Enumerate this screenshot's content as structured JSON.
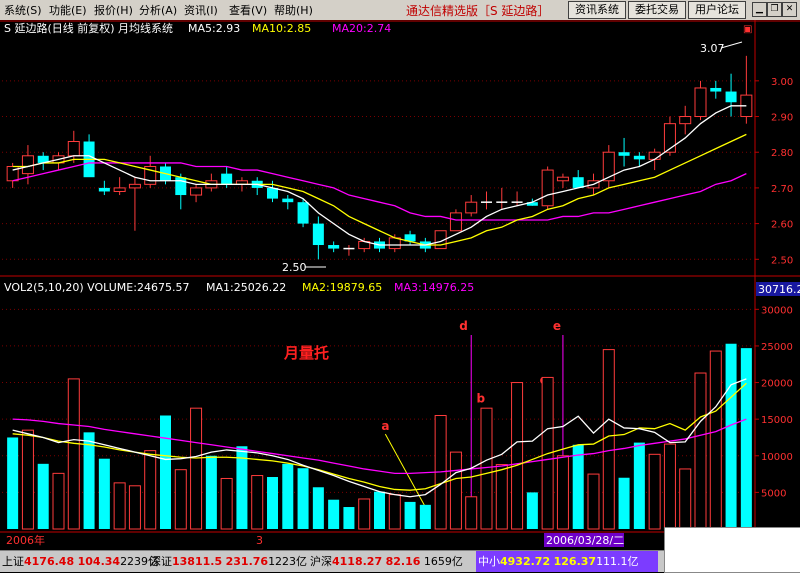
{
  "menubar": {
    "items": [
      "系统(S)",
      "功能(E)",
      "报价(H)",
      "分析(A)",
      "资讯(I)",
      "查看(V)",
      "帮助(H)"
    ],
    "app_title": "通达信精选版［S 延边路］",
    "buttons": [
      "资讯系统",
      "委托交易",
      "用户论坛"
    ],
    "window_controls": [
      "minimize-icon",
      "restore-icon",
      "close-icon"
    ]
  },
  "price_panel": {
    "title": "S 延边路(日线 前复权) 月均线系统",
    "ma5": "MA5:2.93",
    "ma10": "MA10:2.85",
    "ma20": "MA20:2.74",
    "peak_label": "3.07",
    "low_label": "2.50",
    "yticks": [
      "3.00",
      "2.90",
      "2.80",
      "2.70",
      "2.60",
      "2.50"
    ]
  },
  "volume_panel": {
    "title": "VOL2(5,10,20) VOLUME:24675.57",
    "ma1": "MA1:25026.22",
    "ma2": "MA2:19879.65",
    "ma3": "MA3:14976.25",
    "top_readout": "30716.2",
    "yticks": [
      "30000",
      "25000",
      "20000",
      "15000",
      "10000",
      "5000"
    ],
    "annotation_title": "月量托",
    "markers": [
      "a",
      "b",
      "c",
      "d",
      "e"
    ],
    "xlabel_left": "2006年",
    "xlabel_mid": "3",
    "date_readout": "2006/03/28/二"
  },
  "colors": {
    "up": "#ff3c3c",
    "down": "#00ffff",
    "ma_white": "#ffffff",
    "ma_yellow": "#ffff00",
    "ma_magenta": "#ff00ff",
    "grid": "#7a0000",
    "axis": "#c00000"
  },
  "chart_data": {
    "type": "candlestick",
    "price": {
      "ylim": [
        2.47,
        3.12
      ],
      "candles": [
        [
          2.72,
          2.77,
          2.7,
          2.76
        ],
        [
          2.74,
          2.82,
          2.71,
          2.79
        ],
        [
          2.79,
          2.8,
          2.75,
          2.77
        ],
        [
          2.77,
          2.8,
          2.75,
          2.79
        ],
        [
          2.79,
          2.86,
          2.77,
          2.83
        ],
        [
          2.83,
          2.85,
          2.74,
          2.73
        ],
        [
          2.7,
          2.72,
          2.68,
          2.69
        ],
        [
          2.69,
          2.73,
          2.68,
          2.7
        ],
        [
          2.7,
          2.73,
          2.58,
          2.71
        ],
        [
          2.71,
          2.79,
          2.7,
          2.76
        ],
        [
          2.76,
          2.77,
          2.71,
          2.72
        ],
        [
          2.73,
          2.74,
          2.64,
          2.68
        ],
        [
          2.68,
          2.71,
          2.66,
          2.7
        ],
        [
          2.7,
          2.74,
          2.69,
          2.72
        ],
        [
          2.74,
          2.76,
          2.7,
          2.71
        ],
        [
          2.71,
          2.73,
          2.69,
          2.72
        ],
        [
          2.72,
          2.73,
          2.68,
          2.7
        ],
        [
          2.7,
          2.72,
          2.66,
          2.67
        ],
        [
          2.67,
          2.68,
          2.64,
          2.66
        ],
        [
          2.66,
          2.67,
          2.59,
          2.6
        ],
        [
          2.6,
          2.62,
          2.5,
          2.54
        ],
        [
          2.54,
          2.55,
          2.52,
          2.53
        ],
        [
          2.53,
          2.54,
          2.51,
          2.53
        ],
        [
          2.53,
          2.56,
          2.52,
          2.55
        ],
        [
          2.55,
          2.56,
          2.52,
          2.53
        ],
        [
          2.53,
          2.57,
          2.52,
          2.56
        ],
        [
          2.57,
          2.58,
          2.54,
          2.55
        ],
        [
          2.55,
          2.56,
          2.52,
          2.53
        ],
        [
          2.53,
          2.58,
          2.53,
          2.58
        ],
        [
          2.58,
          2.64,
          2.58,
          2.63
        ],
        [
          2.63,
          2.68,
          2.62,
          2.66
        ],
        [
          2.66,
          2.69,
          2.64,
          2.66
        ],
        [
          2.66,
          2.7,
          2.64,
          2.66
        ],
        [
          2.66,
          2.69,
          2.65,
          2.66
        ],
        [
          2.66,
          2.67,
          2.65,
          2.65
        ],
        [
          2.65,
          2.76,
          2.64,
          2.75
        ],
        [
          2.72,
          2.74,
          2.7,
          2.73
        ],
        [
          2.73,
          2.75,
          2.7,
          2.7
        ],
        [
          2.7,
          2.74,
          2.68,
          2.72
        ],
        [
          2.72,
          2.82,
          2.7,
          2.8
        ],
        [
          2.8,
          2.84,
          2.76,
          2.79
        ],
        [
          2.79,
          2.8,
          2.76,
          2.78
        ],
        [
          2.78,
          2.81,
          2.75,
          2.8
        ],
        [
          2.8,
          2.9,
          2.79,
          2.88
        ],
        [
          2.88,
          2.93,
          2.85,
          2.9
        ],
        [
          2.9,
          3.0,
          2.89,
          2.98
        ],
        [
          2.98,
          3.0,
          2.95,
          2.97
        ],
        [
          2.97,
          3.02,
          2.9,
          2.94
        ],
        [
          2.9,
          3.07,
          2.88,
          2.96
        ]
      ],
      "ma5": [
        2.75,
        2.76,
        2.77,
        2.78,
        2.79,
        2.79,
        2.77,
        2.75,
        2.73,
        2.72,
        2.72,
        2.72,
        2.71,
        2.71,
        2.71,
        2.71,
        2.71,
        2.7,
        2.69,
        2.67,
        2.63,
        2.6,
        2.57,
        2.55,
        2.54,
        2.54,
        2.54,
        2.54,
        2.55,
        2.57,
        2.59,
        2.62,
        2.64,
        2.65,
        2.66,
        2.68,
        2.69,
        2.7,
        2.71,
        2.73,
        2.75,
        2.76,
        2.78,
        2.81,
        2.84,
        2.88,
        2.91,
        2.93,
        2.93
      ],
      "ma10": [
        2.76,
        2.76,
        2.77,
        2.77,
        2.78,
        2.78,
        2.78,
        2.77,
        2.76,
        2.75,
        2.74,
        2.73,
        2.72,
        2.71,
        2.71,
        2.71,
        2.71,
        2.71,
        2.7,
        2.69,
        2.67,
        2.65,
        2.62,
        2.6,
        2.58,
        2.56,
        2.55,
        2.54,
        2.54,
        2.55,
        2.56,
        2.58,
        2.59,
        2.61,
        2.62,
        2.64,
        2.65,
        2.67,
        2.68,
        2.7,
        2.71,
        2.72,
        2.73,
        2.75,
        2.77,
        2.79,
        2.81,
        2.83,
        2.85
      ],
      "ma20": [
        2.72,
        2.73,
        2.74,
        2.75,
        2.76,
        2.77,
        2.77,
        2.77,
        2.77,
        2.77,
        2.77,
        2.77,
        2.76,
        2.76,
        2.76,
        2.75,
        2.75,
        2.74,
        2.73,
        2.72,
        2.71,
        2.7,
        2.68,
        2.67,
        2.66,
        2.65,
        2.63,
        2.62,
        2.62,
        2.61,
        2.61,
        2.61,
        2.61,
        2.61,
        2.61,
        2.61,
        2.62,
        2.62,
        2.63,
        2.63,
        2.64,
        2.65,
        2.66,
        2.67,
        2.68,
        2.69,
        2.71,
        2.72,
        2.74
      ]
    },
    "volume": {
      "ylim": [
        0,
        31000
      ],
      "values": [
        12500,
        13500,
        8900,
        7600,
        20500,
        13200,
        9600,
        6300,
        5900,
        10700,
        15500,
        8100,
        16500,
        10000,
        6900,
        11300,
        7300,
        7100,
        8900,
        8300,
        5700,
        4000,
        3000,
        4100,
        5100,
        4700,
        3700,
        3300,
        15500,
        10500,
        4400,
        16500,
        8800,
        20000,
        5000,
        20700,
        10000,
        11500,
        7500,
        24500,
        7000,
        11800,
        10200,
        11600,
        8200,
        21300,
        24300,
        25300,
        24700
      ],
      "up": [
        false,
        true,
        false,
        true,
        true,
        false,
        false,
        true,
        true,
        true,
        false,
        true,
        true,
        false,
        true,
        false,
        true,
        false,
        false,
        false,
        false,
        false,
        false,
        true,
        false,
        true,
        false,
        false,
        true,
        true,
        true,
        true,
        true,
        true,
        false,
        true,
        true,
        false,
        true,
        true,
        false,
        false,
        true,
        true,
        true,
        true,
        true,
        false,
        false
      ],
      "ma1": [
        13500,
        13000,
        12500,
        11800,
        12200,
        12000,
        11500,
        11000,
        10500,
        10000,
        9500,
        9600,
        9900,
        10500,
        10800,
        10600,
        10400,
        10000,
        9500,
        8700,
        8000,
        7300,
        6500,
        5800,
        5100,
        4700,
        4400,
        4700,
        6100,
        7700,
        8300,
        9400,
        10200,
        11900,
        12000,
        13700,
        14000,
        15400,
        13100,
        15000,
        13800,
        13700,
        13200,
        11800,
        11900,
        14700,
        16700,
        19700,
        20500
      ],
      "ma2": [
        13000,
        12800,
        12500,
        12000,
        11700,
        11500,
        11200,
        10800,
        10500,
        10200,
        10000,
        9800,
        9700,
        9800,
        9800,
        9700,
        9500,
        9300,
        9000,
        8600,
        8100,
        7500,
        6900,
        6400,
        5800,
        5400,
        5300,
        5500,
        6200,
        6900,
        7100,
        7600,
        8100,
        8700,
        9500,
        10300,
        10900,
        11500,
        11600,
        12700,
        12900,
        13800,
        13700,
        14400,
        13500,
        15300,
        16100,
        18000,
        19900
      ],
      "ma3": [
        15000,
        14900,
        14700,
        14400,
        14200,
        14000,
        13600,
        13300,
        13000,
        12700,
        12400,
        12100,
        11800,
        11500,
        11200,
        10900,
        10600,
        10300,
        10000,
        9700,
        9400,
        9000,
        8600,
        8200,
        7900,
        7600,
        7600,
        7700,
        7800,
        8000,
        8200,
        8400,
        8600,
        8900,
        9200,
        9500,
        9800,
        10100,
        10300,
        10700,
        11000,
        11400,
        11700,
        12000,
        12300,
        12800,
        13300,
        14200,
        15000
      ]
    }
  }
}
